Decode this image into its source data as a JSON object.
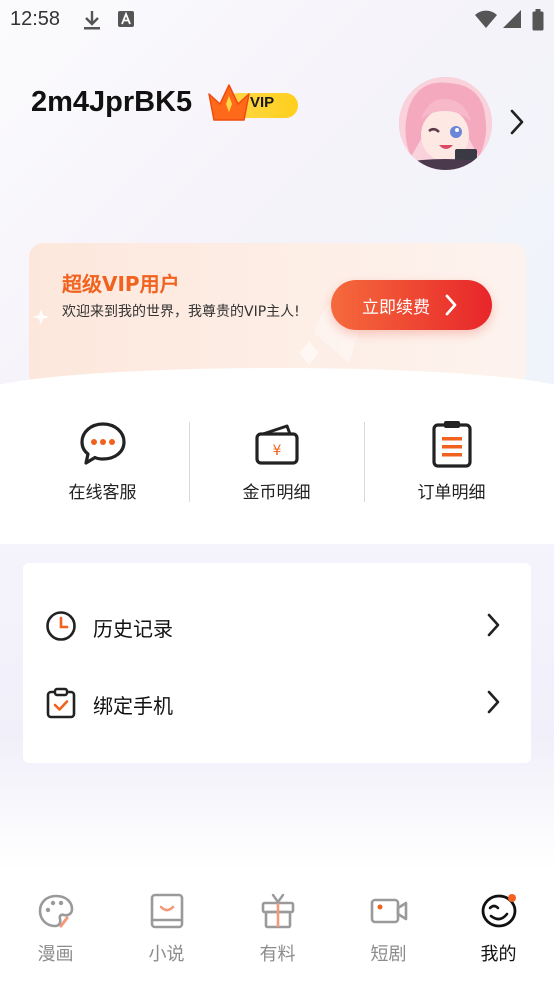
{
  "status_bar": {
    "time": "12:58"
  },
  "profile": {
    "username": "2m4JprBK5",
    "vip_badge": "VIP"
  },
  "vip_card": {
    "title": "超级VIP用户",
    "description": "欢迎来到我的世界，我尊贵的VIP主人!",
    "renew_button": "立即续费"
  },
  "quick_actions": [
    {
      "label": "在线客服",
      "icon": "chat-bubble-icon"
    },
    {
      "label": "金币明细",
      "icon": "wallet-icon"
    },
    {
      "label": "订单明细",
      "icon": "order-list-icon"
    }
  ],
  "list": [
    {
      "label": "历史记录",
      "icon": "clock-icon"
    },
    {
      "label": "绑定手机",
      "icon": "clipboard-check-icon"
    }
  ],
  "bottom_nav": [
    {
      "label": "漫画",
      "icon": "palette-icon",
      "active": false
    },
    {
      "label": "小说",
      "icon": "book-icon",
      "active": false
    },
    {
      "label": "有料",
      "icon": "gift-icon",
      "active": false
    },
    {
      "label": "短剧",
      "icon": "video-camera-icon",
      "active": false
    },
    {
      "label": "我的",
      "icon": "profile-face-icon",
      "active": true
    }
  ],
  "colors": {
    "accent_orange": "#f0621d",
    "button_red": "#e8262a",
    "vip_gold": "#ffd24a",
    "nav_active": "#111111",
    "nav_inactive": "#8c8c8c"
  }
}
